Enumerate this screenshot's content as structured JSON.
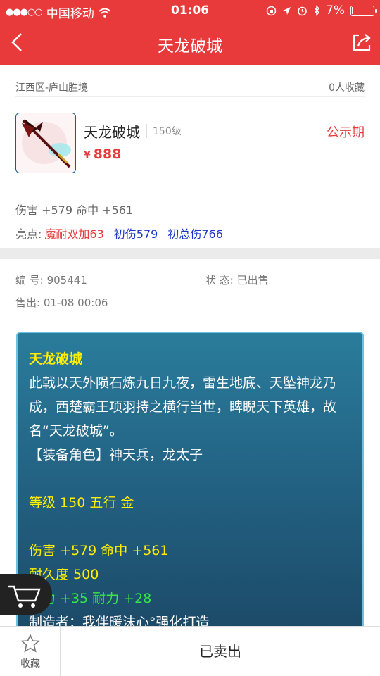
{
  "status_bar": {
    "carrier": "中国移动",
    "time": "01:06",
    "battery": "7%",
    "battery_level": 0.07
  },
  "nav": {
    "title": "天龙破城"
  },
  "breadcrumb": {
    "location": "江西区-庐山胜境",
    "favorites": "0人收藏"
  },
  "item": {
    "name": "天龙破城",
    "level": "150级",
    "price": "888",
    "currency": "¥",
    "status": "公示期"
  },
  "attributes": {
    "line": "伤害 +579 命中 +561",
    "highlight_label": "亮点:",
    "highlights": [
      "魔耐双加63",
      "初伤579",
      "初总伤766"
    ]
  },
  "meta": {
    "serial": "编  号: 905441",
    "state": "状  态: 已出售",
    "sold_time": "售出: 01-08 00:06"
  },
  "description": {
    "title": "天龙破城",
    "story": "此戟以天外陨石炼九日九夜，雷生地底、天坠神龙乃成，西楚霸王项羽持之横行当世，睥睨天下英雄，故名“天龙破城”。",
    "roles": "【装备角色】神天兵，龙太子",
    "level_line": "等级 150 五行 金",
    "damage_line": "伤害 +579 命中 +561",
    "durability_line": "耐久度 500",
    "bonus_line": "魔力 +35 耐力 +28",
    "maker_line": "制造者：我伴暖沫心°强化打造"
  },
  "bottom_bar": {
    "favorite_label": "收藏",
    "sold_label": "已卖出"
  },
  "colors": {
    "brand_red": "#e8393b",
    "panel_blue": "#225f80",
    "highlight_yellow": "#ffef00",
    "bonus_green": "#39e64a",
    "highlight_blue": "#1a33c9"
  },
  "icons": {
    "back": "chevron-left-icon",
    "share": "share-icon",
    "favorite": "star-icon",
    "cart": "cart-icon"
  }
}
